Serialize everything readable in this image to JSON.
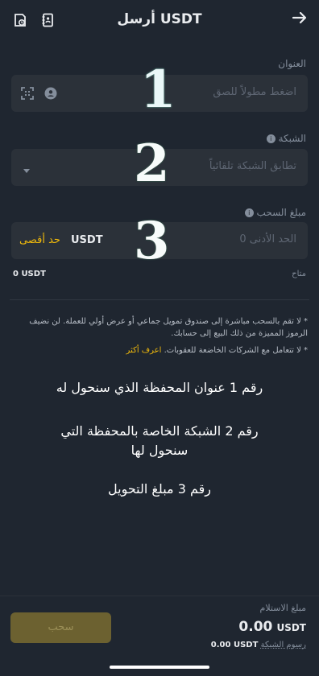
{
  "header": {
    "title": "أرسل USDT",
    "back_icon": "arrow-right-icon",
    "history_icon": "history-icon",
    "contacts_icon": "address-book-icon"
  },
  "address": {
    "label": "العنوان",
    "placeholder": "اضغط مطولاً للصق"
  },
  "network": {
    "label": "الشبكة",
    "placeholder": "تطابق الشبكة تلقائياً"
  },
  "amount": {
    "label": "مبلغ السحب",
    "placeholder": "الحد الأدنى 0",
    "currency": "USDT",
    "max_label": "حد أقصى",
    "available_label": "متاح",
    "available_value": "0 USDT"
  },
  "annotations": {
    "n1": "1",
    "n2": "2",
    "n3": "3"
  },
  "notes": {
    "line1": "* لا تقم بالسحب مباشرة إلى صندوق تمويل جماعي أو عرض أولي للعملة. لن نضيف الرموز المميزة من ذلك البيع إلى حسابك.",
    "line2": "* لا تتعامل مع الشركات الخاضعة للعقوبات.",
    "learn_more": "اعرف أكثر"
  },
  "captions": {
    "c1": "رقم 1 عنوان المحفظة الذي سنحول له",
    "c2": "رقم 2 الشبكة الخاصة بالمحفظة التي سنحول لها",
    "c3": "رقم 3 مبلغ التحويل"
  },
  "footer": {
    "receive_label": "مبلغ الاستلام",
    "receive_value": "0.00",
    "receive_currency": "USDT",
    "fee_label": "رسوم الشبكة",
    "fee_value": "0.00 USDT",
    "withdraw_label": "سحب"
  },
  "colors": {
    "accent": "#f0b90b",
    "background": "#1f2630",
    "field": "#2b3139"
  }
}
